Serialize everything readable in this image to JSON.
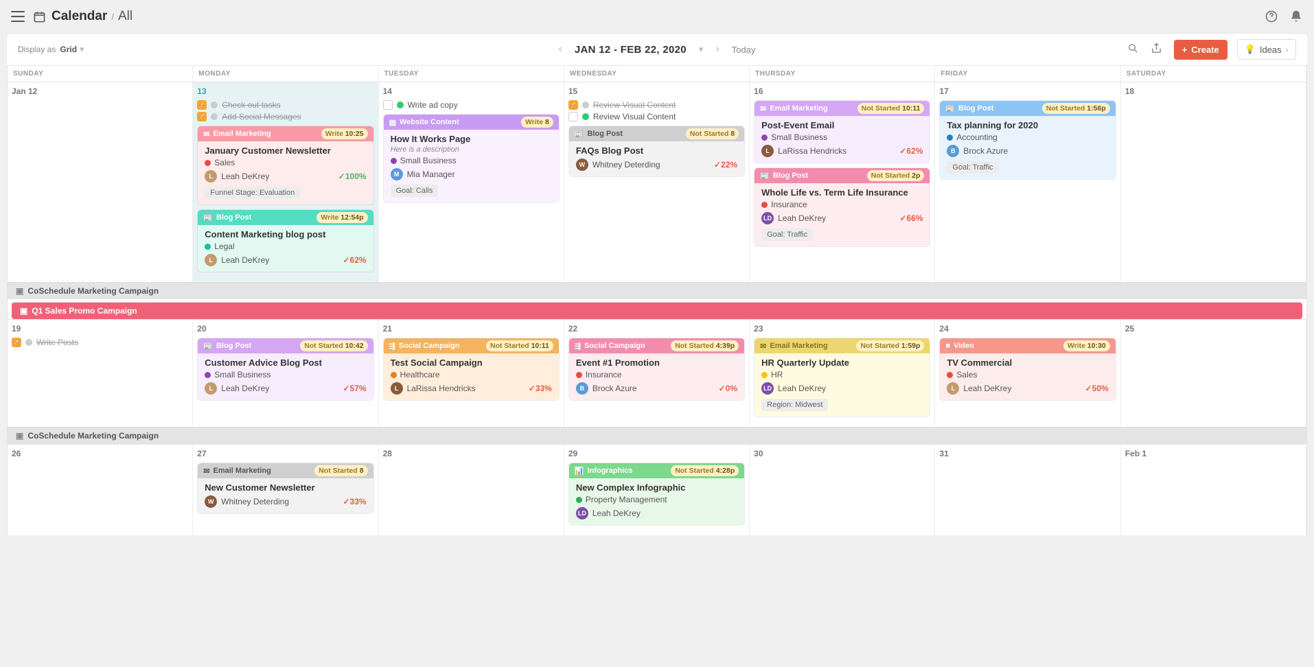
{
  "header": {
    "title": "Calendar",
    "subtitle": "All"
  },
  "controls": {
    "displayAsLabel": "Display as",
    "displayAsValue": "Grid",
    "dateRange": "JAN 12 - FEB 22, 2020",
    "today": "Today",
    "create": "Create",
    "ideas": "Ideas"
  },
  "dayNames": [
    "SUNDAY",
    "MONDAY",
    "TUESDAY",
    "WEDNESDAY",
    "THURSDAY",
    "FRIDAY",
    "SATURDAY"
  ],
  "week1": {
    "dates": [
      "Jan 12",
      "13",
      "14",
      "15",
      "16",
      "17",
      "18"
    ],
    "mon": {
      "tasks": [
        {
          "label": "Check out tasks",
          "done": true
        },
        {
          "label": "Add Social Messages",
          "done": true
        }
      ],
      "card1": {
        "type": "Email Marketing",
        "status": "Write",
        "time": "10:25",
        "title": "January Customer Newsletter",
        "tag": "Sales",
        "tagColor": "#e74c3c",
        "assignee": "Leah DeKrey",
        "pct": "100%",
        "chip": "Funnel Stage: Evaluation"
      },
      "card2": {
        "type": "Blog Post",
        "status": "Write",
        "time": "12:54p",
        "title": "Content Marketing blog post",
        "tag": "Legal",
        "tagColor": "#1abc9c",
        "assignee": "Leah DeKrey",
        "pct": "62%"
      }
    },
    "tue": {
      "task": {
        "label": "Write ad copy",
        "done": false,
        "dotColor": "#2ecc71"
      },
      "card": {
        "type": "Website Content",
        "status": "Write",
        "time": "8",
        "title": "How It Works Page",
        "desc": "Here is a description",
        "tag": "Small Business",
        "tagColor": "#8e44ad",
        "assignee": "Mia Manager",
        "chip": "Goal: Calls"
      }
    },
    "wed": {
      "tasks": [
        {
          "label": "Review Visual Content",
          "done": true,
          "dotColor": "#2ecc71"
        },
        {
          "label": "Review Visual Content",
          "done": false,
          "dotColor": "#2ecc71"
        }
      ],
      "card": {
        "type": "Blog Post",
        "status": "Not Started",
        "time": "8",
        "title": "FAQs Blog Post",
        "assignee": "Whitney Deterding",
        "pct": "22%"
      }
    },
    "thu": {
      "card1": {
        "type": "Email Marketing",
        "status": "Not Started",
        "time": "10:11",
        "title": "Post-Event Email",
        "tag": "Small Business",
        "tagColor": "#8e44ad",
        "assignee": "LaRissa Hendricks",
        "pct": "62%"
      },
      "card2": {
        "type": "Blog Post",
        "status": "Not Started",
        "time": "2p",
        "title": "Whole Life vs. Term Life Insurance",
        "tag": "Insurance",
        "tagColor": "#e74c3c",
        "assignee": "Leah DeKrey",
        "pct": "66%",
        "chip": "Goal: Traffic"
      }
    },
    "fri": {
      "card": {
        "type": "Blog Post",
        "status": "Not Started",
        "time": "1:56p",
        "title": "Tax planning for 2020",
        "tag": "Accounting",
        "tagColor": "#2980b9",
        "assignee": "Brock Azure",
        "chip": "Goal: Traffic"
      }
    }
  },
  "campaign1": "CoSchedule Marketing Campaign",
  "campaign2": "Q1 Sales Promo Campaign",
  "week2": {
    "dates": [
      "19",
      "20",
      "21",
      "22",
      "23",
      "24",
      "25"
    ],
    "sun": {
      "task": {
        "label": "Write Posts",
        "done": true
      }
    },
    "mon": {
      "card": {
        "type": "Blog Post",
        "status": "Not Started",
        "time": "10:42",
        "title": "Customer Advice Blog Post",
        "tag": "Small Business",
        "tagColor": "#8e44ad",
        "assignee": "Leah DeKrey",
        "pct": "57%"
      }
    },
    "tue": {
      "card": {
        "type": "Social Campaign",
        "status": "Not Started",
        "time": "10:11",
        "title": "Test Social Campaign",
        "tag": "Healthcare",
        "tagColor": "#e67e22",
        "assignee": "LaRissa Hendricks",
        "pct": "33%"
      }
    },
    "wed": {
      "card": {
        "type": "Social Campaign",
        "status": "Not Started",
        "time": "4:39p",
        "title": "Event #1 Promotion",
        "tag": "Insurance",
        "tagColor": "#e74c3c",
        "assignee": "Brock Azure",
        "pct": "0%"
      }
    },
    "thu": {
      "card": {
        "type": "Email Marketing",
        "status": "Not Started",
        "time": "1:59p",
        "title": "HR Quarterly Update",
        "tag": "HR",
        "tagColor": "#f1c40f",
        "assignee": "Leah DeKrey",
        "chip": "Region: Midwest"
      }
    },
    "fri": {
      "card": {
        "type": "Video",
        "status": "Write",
        "time": "10:30",
        "title": "TV Commercial",
        "tag": "Sales",
        "tagColor": "#e74c3c",
        "assignee": "Leah DeKrey",
        "pct": "50%"
      }
    }
  },
  "campaign3": "CoSchedule Marketing Campaign",
  "week3": {
    "dates": [
      "26",
      "27",
      "28",
      "29",
      "30",
      "31",
      "Feb 1"
    ],
    "mon": {
      "card": {
        "type": "Email Marketing",
        "status": "Not Started",
        "time": "8",
        "title": "New Customer Newsletter",
        "assignee": "Whitney Deterding",
        "pct": "33%"
      }
    },
    "wed": {
      "card": {
        "type": "Infographics",
        "status": "Not Started",
        "time": "4:28p",
        "title": "New Complex Infographic",
        "tag": "Property Management",
        "tagColor": "#27ae60",
        "assignee": "Leah DeKrey"
      }
    }
  }
}
